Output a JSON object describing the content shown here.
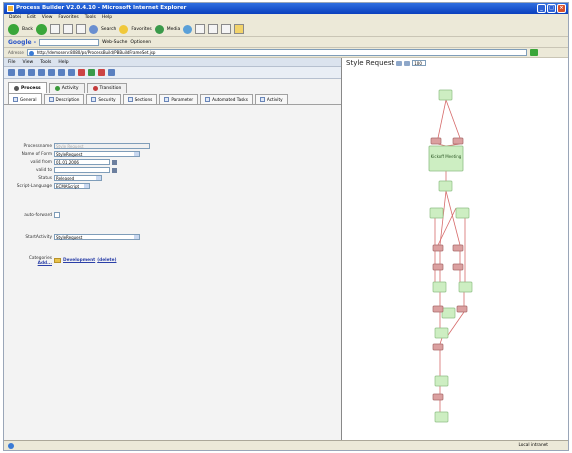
{
  "window": {
    "title": "Process Builder V2.0.4.10 - Microsoft Internet Explorer"
  },
  "ie_menu": [
    "Datei",
    "Edit",
    "View",
    "Favorites",
    "Tools",
    "Help"
  ],
  "toolbar": {
    "back": "Back",
    "search": "Search",
    "favorites": "Favorites",
    "media": "Media"
  },
  "google": {
    "logo": "Google -",
    "websuche": "Web-Suche",
    "optionen": "Optionen"
  },
  "address": {
    "label": "Adresse",
    "url": "http://demoserv:8080/ps/ProcessBuild/PBBuildFrameSet.jsp",
    "go": "Wechseln zu"
  },
  "app_menu": [
    "File",
    "View",
    "Tools",
    "Help"
  ],
  "main_tabs": [
    {
      "label": "Process",
      "dot": "#555555",
      "active": true
    },
    {
      "label": "Activity",
      "dot": "#3a9a3a",
      "active": false
    },
    {
      "label": "Transition",
      "dot": "#c43a3a",
      "active": false
    }
  ],
  "sub_tabs": [
    {
      "label": "General",
      "active": true
    },
    {
      "label": "Description",
      "active": false
    },
    {
      "label": "Security",
      "active": false
    },
    {
      "label": "Sections",
      "active": false
    },
    {
      "label": "Parameter",
      "active": false
    },
    {
      "label": "Automated Tasks",
      "active": false
    },
    {
      "label": "Activity",
      "active": false
    }
  ],
  "form": {
    "processname_label": "Processname",
    "processname_value": "Style Request",
    "name_of_form_label": "Name of Form",
    "name_of_form_value": "StyleRequest",
    "valid_from_label": "valid from",
    "valid_from_value": "01.01.2006",
    "valid_to_label": "valid to",
    "valid_to_value": "",
    "status_label": "Status",
    "status_value": "Released",
    "script_language_label": "Script-Language",
    "script_language_value": "ECMAScript",
    "auto_forward_label": "auto-forward",
    "start_activity_label": "StartActivity",
    "start_activity_value": "StyleRequest",
    "categories_label": "Categories",
    "categories_add": "Add...",
    "category_name": "Development",
    "category_delete": "(delete)"
  },
  "workflow": {
    "title": "Style Request",
    "zoom": "100",
    "meeting_label": "Kickoff Meeting"
  },
  "statusbar": {
    "left": "",
    "zone": "Local intranet"
  },
  "colors": {
    "activity_fill": "#cdeec2",
    "activity_stroke": "#8fbf85",
    "transition_fill": "#dba0a0",
    "transition_stroke": "#a86a6a",
    "link": "#d66a6a"
  }
}
